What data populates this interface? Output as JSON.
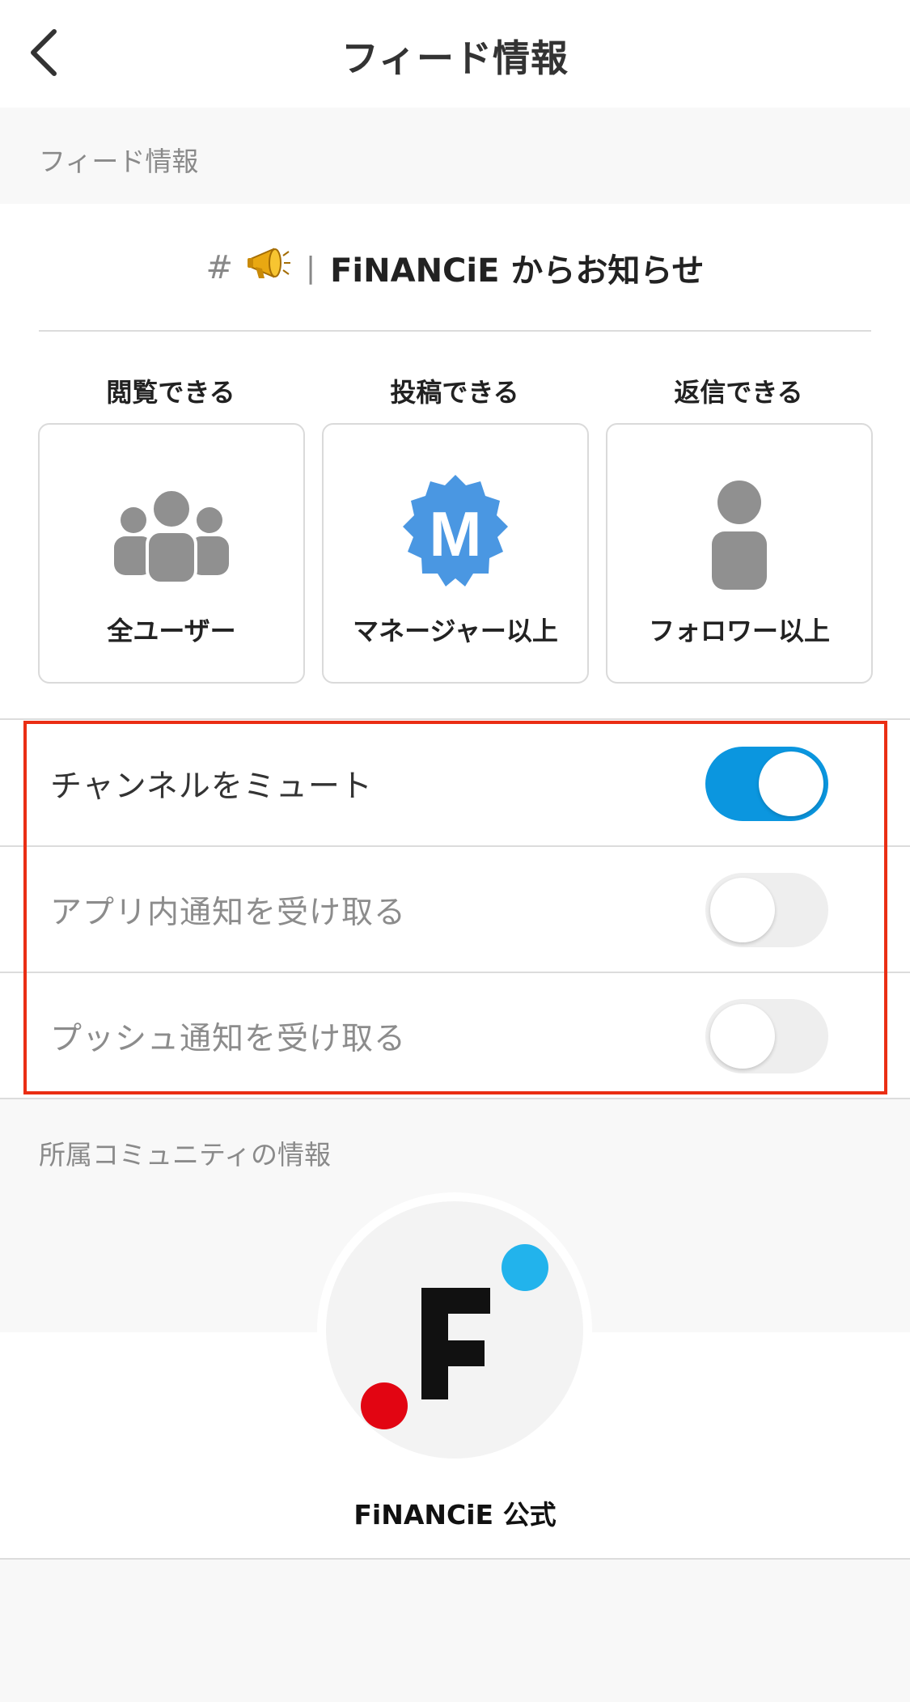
{
  "header": {
    "title": "フィード情報",
    "back_icon": "chevron-left-icon"
  },
  "feed_section": {
    "label": "フィード情報"
  },
  "channel": {
    "hash": "#",
    "emoji": "📣",
    "separator": "|",
    "name": "FiNANCiE からお知らせ"
  },
  "permissions": [
    {
      "title": "閲覧できる",
      "icon": "users-group-icon",
      "label": "全ユーザー"
    },
    {
      "title": "投稿できる",
      "icon": "manager-badge-icon",
      "badge_letter": "M",
      "label": "マネージャー以上"
    },
    {
      "title": "返信できる",
      "icon": "user-icon",
      "label": "フォロワー以上"
    }
  ],
  "settings": [
    {
      "label": "チャンネルをミュート",
      "enabled": true
    },
    {
      "label": "アプリ内通知を受け取る",
      "enabled": false
    },
    {
      "label": "プッシュ通知を受け取る",
      "enabled": false
    }
  ],
  "community_section": {
    "label": "所属コミュニティの情報",
    "name": "FiNANCiE 公式",
    "logo": "financie-logo"
  },
  "colors": {
    "accent": "#0b96df",
    "highlight_border": "#ea2e14",
    "badge_blue": "#4a97e2",
    "icon_gray": "#909090",
    "logo_blue": "#22b3ec",
    "logo_red": "#e20512"
  }
}
